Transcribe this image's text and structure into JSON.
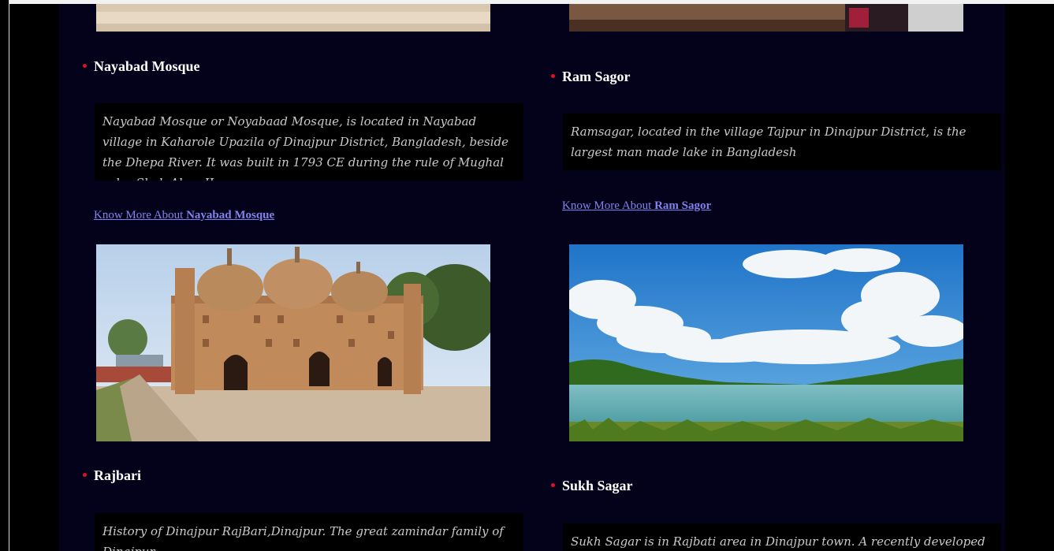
{
  "left": {
    "nayabad": {
      "title": "Nayabad Mosque",
      "description": "Nayabad Mosque or Noyabaad Mosque, is located in Nayabad village in Kaharole Upazila of Dinajpur District, Bangladesh, beside the Dhepa River. It was built in 1793 CE during the rule of Mughal ruler Shah Alam II",
      "link_prefix": "Know More About ",
      "link_bold": "Nayabad Mosque",
      "image_alt": "Nayabad Mosque photo"
    },
    "rajbari": {
      "title": "Rajbari",
      "description": "History of Dinajpur RajBari,Dinajpur. The great zamindar family of Dinajpur,"
    }
  },
  "right": {
    "ramsagor": {
      "title": "Ram Sagor",
      "description": "Ramsagar, located in the village Tajpur in Dinajpur District, is the largest man made lake in Bangladesh",
      "link_prefix": "Know More About ",
      "link_bold": "Ram Sagor",
      "image_alt": "Ram Sagor lake photo"
    },
    "sukhsagar": {
      "title": "Sukh Sagar",
      "description": "Sukh Sagar is in Rajbati area in Dinajpur town. A recently developed park for"
    }
  },
  "colors": {
    "panel_bg": "#04021a",
    "bullet": "#e0102a",
    "link": "#8282ee"
  }
}
